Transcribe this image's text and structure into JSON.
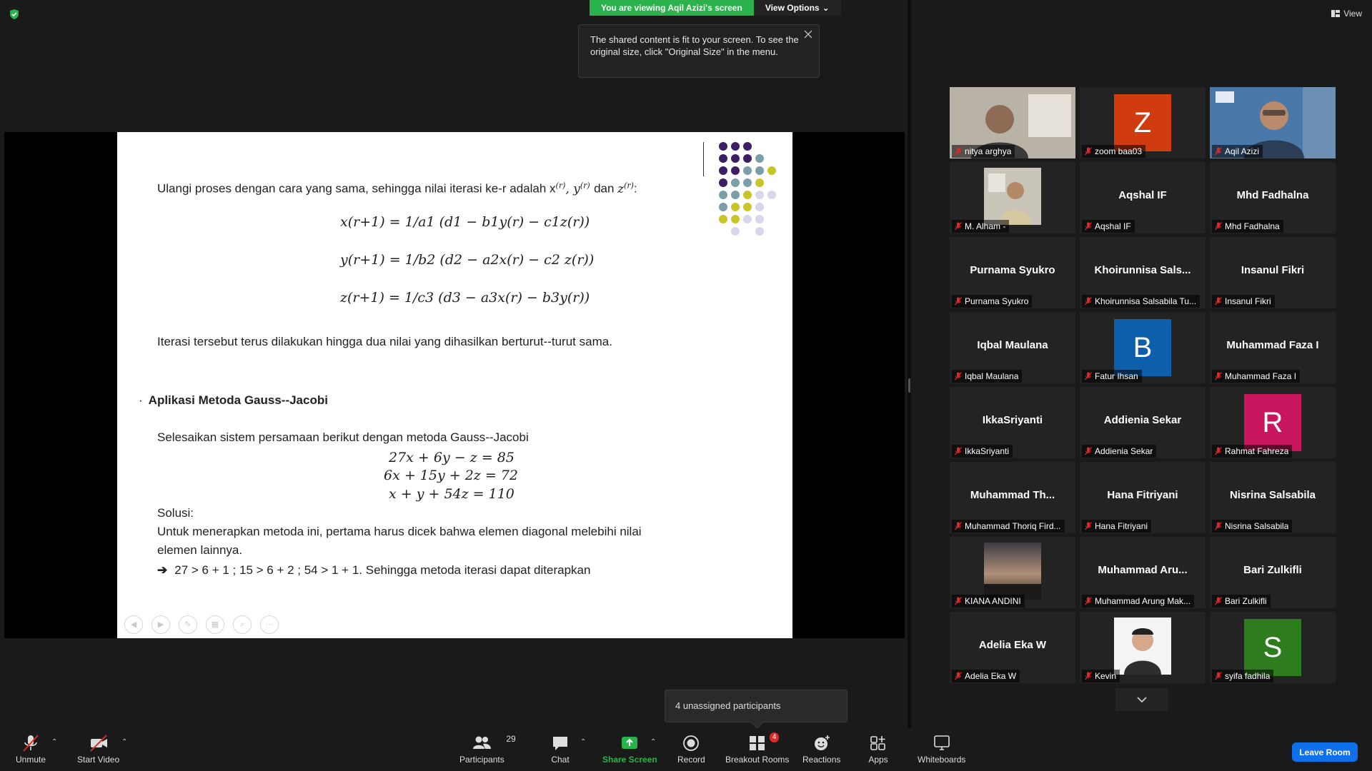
{
  "banner": {
    "viewing_text": "You are viewing Aqil Azizi's screen",
    "view_options_label": "View Options"
  },
  "tooltip": {
    "text": "The shared content is fit to your screen. To see the original size, click \"Original Size\" in the menu."
  },
  "slide": {
    "intro_line": "Ulangi proses dengan cara yang sama, sehingga nilai iterasi ke-r adalah x",
    "eq1": "x(r+1) = 1/a1 (d1 − b1y(r) − c1z(r))",
    "eq2": "y(r+1) = 1/b2 (d2 − a2x(r) − c2 z(r))",
    "eq3": "z(r+1) = 1/c3 (d3 − a3x(r) − b3y(r))",
    "iter_line": "Iterasi tersebut terus dilakukan hingga dua nilai yang dihasilkan berturut--turut sama.",
    "heading": "Aplikasi Metoda Gauss--Jacobi",
    "task_line": "Selesaikan sistem persamaan berikut dengan metoda Gauss--Jacobi",
    "sys1": "27x + 6y − z = 85",
    "sys2": "6x + 15y + 2z = 72",
    "sys3": "x + y + 54z = 110",
    "solusi": "Solusi:",
    "sol_line1": "Untuk menerapkan metoda ini, pertama harus dicek bahwa elemen diagonal melebihi nilai",
    "sol_line2": "elemen lainnya.",
    "sol_line3": "27 > 6 + 1 ; 15 > 6 + 2 ; 54 > 1 + 1. Sehingga metoda iterasi dapat diterapkan"
  },
  "gallery": {
    "view_label": "View",
    "tiles": [
      {
        "label": "nitya arghya",
        "big": "",
        "type": "photo"
      },
      {
        "label": "zoom baa03",
        "big": "",
        "type": "avatar",
        "letter": "Z",
        "color": "#d13c0f"
      },
      {
        "label": "Aqil Azizi",
        "big": "",
        "type": "photo-full",
        "active": true
      },
      {
        "label": "M. Alham -",
        "big": "",
        "type": "photo"
      },
      {
        "label": "Aqshal IF",
        "big": "Aqshal IF",
        "type": "name"
      },
      {
        "label": "Mhd Fadhalna",
        "big": "Mhd Fadhalna",
        "type": "name"
      },
      {
        "label": "Purnama Syukro",
        "big": "Purnama Syukro",
        "type": "name"
      },
      {
        "label": "Khoirunnisa Salsabila Tu...",
        "big": "Khoirunnisa  Sals...",
        "type": "name"
      },
      {
        "label": "Insanul Fikri",
        "big": "Insanul Fikri",
        "type": "name"
      },
      {
        "label": "Iqbal Maulana",
        "big": "Iqbal Maulana",
        "type": "name"
      },
      {
        "label": "Fatur Ihsan",
        "big": "",
        "type": "avatar",
        "letter": "B",
        "color": "#0d5eab"
      },
      {
        "label": "Muhammad Faza I",
        "big": "Muhammad Faza I",
        "type": "name"
      },
      {
        "label": "IkkaSriyanti",
        "big": "IkkaSriyanti",
        "type": "name"
      },
      {
        "label": "Addienia Sekar",
        "big": "Addienia Sekar",
        "type": "name"
      },
      {
        "label": "Rahmat Fahreza",
        "big": "",
        "type": "avatar",
        "letter": "R",
        "color": "#c8175f"
      },
      {
        "label": "Muhammad Thoriq Fird...",
        "big": "Muhammad  Th...",
        "type": "name"
      },
      {
        "label": "Hana Fitriyani",
        "big": "Hana Fitriyani",
        "type": "name"
      },
      {
        "label": "Nisrina Salsabila",
        "big": "Nisrina Salsabila",
        "type": "name"
      },
      {
        "label": "KIANA ANDINI",
        "big": "",
        "type": "photo-sunset"
      },
      {
        "label": "Muhammad Arung Mak...",
        "big": "Muhammad  Aru...",
        "type": "name"
      },
      {
        "label": "Bari Zulkifli",
        "big": "Bari Zulkifli",
        "type": "name"
      },
      {
        "label": "Adelia Eka W",
        "big": "Adelia Eka W",
        "type": "name"
      },
      {
        "label": "Kevin",
        "big": "",
        "type": "photo-portrait"
      },
      {
        "label": "syifa fadhila",
        "big": "",
        "type": "avatar",
        "letter": "S",
        "color": "#2d7d1f"
      }
    ]
  },
  "popover": {
    "text": "4 unassigned participants"
  },
  "toolbar": {
    "unmute": "Unmute",
    "start_video": "Start Video",
    "participants": "Participants",
    "participants_count": "29",
    "chat": "Chat",
    "share_screen": "Share Screen",
    "record": "Record",
    "breakout_rooms": "Breakout Rooms",
    "breakout_badge": "4",
    "reactions": "Reactions",
    "apps": "Apps",
    "whiteboards": "Whiteboards",
    "leave": "Leave Room"
  }
}
